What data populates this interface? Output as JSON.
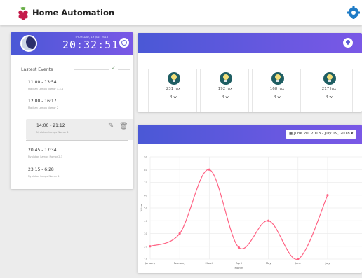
{
  "header": {
    "title": "Home Automation",
    "logo_icon": "raspberry-pi-logo",
    "settings_icon": "gear-icon"
  },
  "clock": {
    "date": "THURSDAY, 19 JULY 2018",
    "time": "20:32:51",
    "icon": "clock-icon",
    "moon_icon": "moon-icon"
  },
  "events": {
    "title": "Lastest Events",
    "check_icon": "check-icon",
    "items": [
      {
        "time": "11:00 - 13:54",
        "desc": "Matikan Lampu Nomor 1-3-4"
      },
      {
        "time": "12:00 - 16:17",
        "desc": "Matikan Lampu Nomor 2"
      },
      {
        "time": "14:00 - 21:12",
        "desc": "Nyalakan Lampu Nomor 4"
      },
      {
        "time": "20:45 - 17:34",
        "desc": "Nyalakan Lampu Nomor 2-3"
      },
      {
        "time": "23:15 - 6:28",
        "desc": "Nyalakan lampu Nomor 1"
      }
    ],
    "edit_icon": "pencil-icon",
    "delete_icon": "trash-icon"
  },
  "sensors": {
    "header_icon": "location-pin-icon",
    "items": [
      {
        "lux": "231 lux",
        "watt": "4 w"
      },
      {
        "lux": "192 lux",
        "watt": "4 w"
      },
      {
        "lux": "168 lux",
        "watt": "4 w"
      },
      {
        "lux": "217 lux",
        "watt": "4 w"
      }
    ]
  },
  "date_range": {
    "label": "June 20, 2018 - July 19, 2018",
    "icon": "calendar-icon"
  },
  "chart_data": {
    "type": "line",
    "categories": [
      "January",
      "February",
      "March",
      "April",
      "May",
      "June",
      "July"
    ],
    "series": [
      {
        "values": [
          20,
          30,
          80,
          19,
          40,
          10,
          60
        ]
      }
    ],
    "xlabel": "Month",
    "ylabel": "Value",
    "ylim": [
      10,
      90
    ],
    "yticks": [
      10,
      20,
      30,
      40,
      50,
      60,
      70,
      80,
      90
    ],
    "grid": true,
    "line_color": "#ff6384"
  }
}
